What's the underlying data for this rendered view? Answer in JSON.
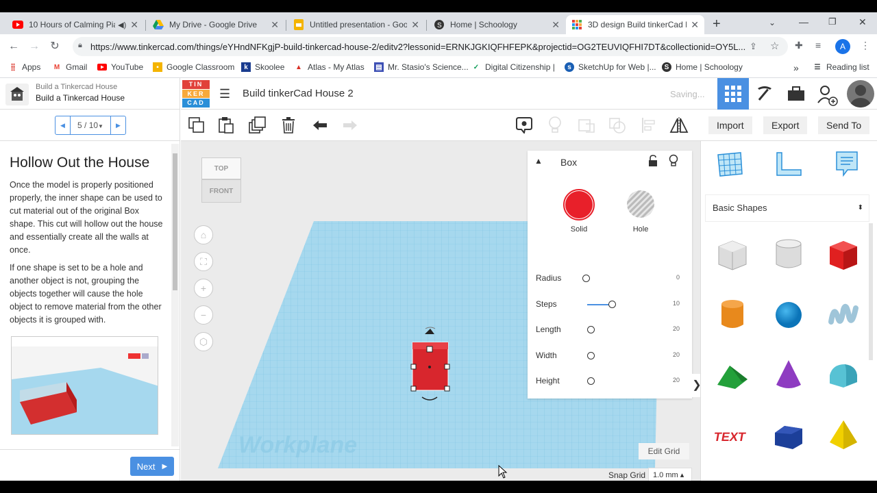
{
  "browser": {
    "tabs": [
      {
        "title": "10 Hours of Calming Pia",
        "icon": "youtube-icon",
        "active": false
      },
      {
        "title": "My Drive - Google Drive",
        "icon": "google-drive-icon",
        "active": false
      },
      {
        "title": "Untitled presentation - Goog",
        "icon": "google-slides-icon",
        "active": false
      },
      {
        "title": "Home | Schoology",
        "icon": "schoology-icon",
        "active": false
      },
      {
        "title": "3D design Build tinkerCad H",
        "icon": "tinkercad-icon",
        "active": true
      }
    ],
    "url": "https://www.tinkercad.com/things/eYHndNFKgjP-build-tinkercad-house-2/editv2?lessonid=ERNKJGKIQFHFEPK&projectid=OG2TEUVIQFHI7DT&collectionid=OY5L...",
    "profile_initial": "A",
    "bookmarks": [
      {
        "label": "Apps",
        "icon": "apps-grid-icon"
      },
      {
        "label": "Gmail",
        "icon": "gmail-icon"
      },
      {
        "label": "YouTube",
        "icon": "youtube-icon"
      },
      {
        "label": "Google Classroom",
        "icon": "classroom-icon"
      },
      {
        "label": "Skoolee",
        "icon": "skoolee-icon"
      },
      {
        "label": "Atlas - My Atlas",
        "icon": "atlas-icon"
      },
      {
        "label": "Mr. Stasio's Science...",
        "icon": "bookmark-page-icon"
      },
      {
        "label": "Digital Citizenship |",
        "icon": "check-icon"
      },
      {
        "label": "SketchUp for Web |...",
        "icon": "sketchup-icon"
      },
      {
        "label": "Home | Schoology",
        "icon": "schoology-icon"
      }
    ],
    "reading_list": "Reading list",
    "more_bookmarks": "»"
  },
  "lesson_panel": {
    "project_title": "Build a Tinkercad House",
    "project_subtitle": "Build a Tinkercad House",
    "pager": "5 / 10",
    "heading": "Hollow Out the House",
    "paragraph1": "Once the model is properly positioned properly, the inner shape can be used to cut material out of the original Box shape. This cut will hollow out the house and essentially create all the walls at once.",
    "paragraph2": "If one shape is set to be a hole and another object is not, grouping the objects together will cause the hole object to remove material from the other objects it is grouped with.",
    "next_label": "Next"
  },
  "header": {
    "logo_letters": [
      "TIN",
      "KER",
      "CAD"
    ],
    "design_name": "Build tinkerCad House 2",
    "saving_status": "Saving..."
  },
  "toolbar": {
    "import_label": "Import",
    "export_label": "Export",
    "send_to_label": "Send To"
  },
  "viewcube": {
    "top": "TOP",
    "front": "FRONT"
  },
  "workplane": {
    "label": "Workplane",
    "edit_grid": "Edit Grid",
    "snap_grid_label": "Snap Grid",
    "snap_grid_value": "1.0 mm ▴"
  },
  "inspector": {
    "shape_name": "Box",
    "solid_label": "Solid",
    "hole_label": "Hole",
    "solid_color": "#e8202a",
    "params": [
      {
        "label": "Radius",
        "value": "0",
        "fraction": 0.0
      },
      {
        "label": "Steps",
        "value": "10",
        "fraction": 0.5
      },
      {
        "label": "Length",
        "value": "20",
        "fraction": 0.0
      },
      {
        "label": "Width",
        "value": "20",
        "fraction": 0.0
      },
      {
        "label": "Height",
        "value": "20",
        "fraction": 0.0
      }
    ]
  },
  "library": {
    "category": "Basic Shapes",
    "shapes": [
      {
        "name": "box-hole-shape"
      },
      {
        "name": "cylinder-hole-shape"
      },
      {
        "name": "box-shape"
      },
      {
        "name": "cylinder-shape"
      },
      {
        "name": "sphere-shape"
      },
      {
        "name": "scribble-shape"
      },
      {
        "name": "roof-shape"
      },
      {
        "name": "cone-shape"
      },
      {
        "name": "round-roof-shape"
      },
      {
        "name": "text-shape"
      },
      {
        "name": "polygon-shape"
      },
      {
        "name": "pyramid-shape"
      }
    ]
  },
  "colors": {
    "accent_blue": "#4a90e2",
    "workplane_blue": "#a6d8ee",
    "next_button": "#4a90e2"
  }
}
